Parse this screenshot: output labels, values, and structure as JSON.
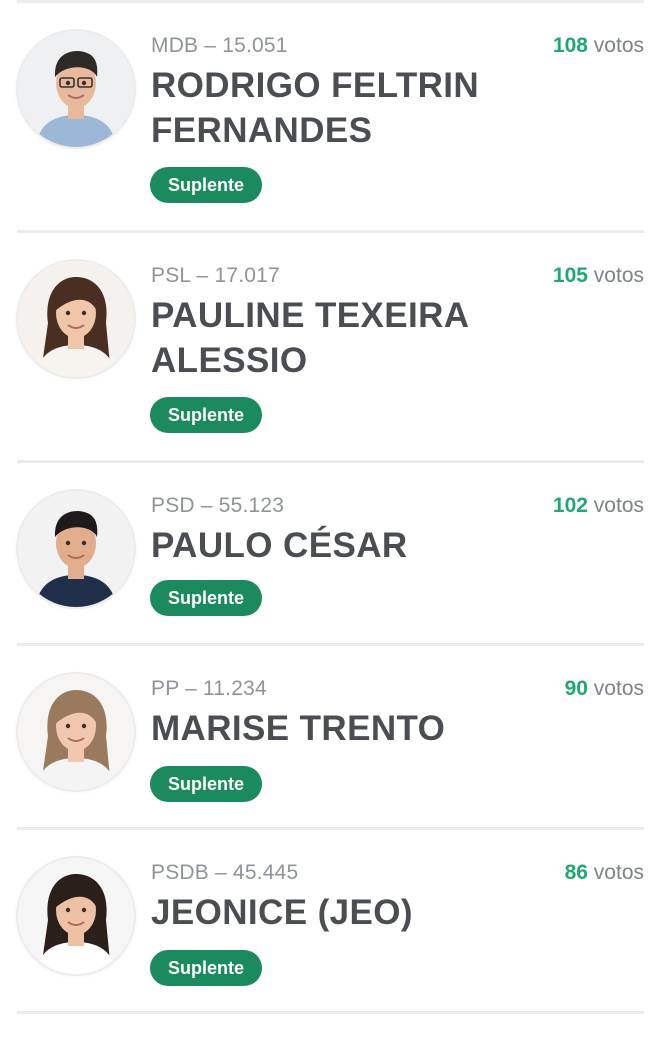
{
  "candidates": [
    {
      "party": "MDB – 15.051",
      "votes_number": "108",
      "votes_unit": " votos",
      "name": "RODRIGO FELTRIN FERNANDES",
      "status": "Suplente",
      "avatar": {
        "skin": "#e8b99a",
        "hair": "#2e2a27",
        "shirt": "#9db8d6",
        "bg": "#eef0f2"
      }
    },
    {
      "party": "PSL – 17.017",
      "votes_number": "105",
      "votes_unit": " votos",
      "name": "PAULINE TEXEIRA ALESSIO",
      "status": "Suplente",
      "avatar": {
        "skin": "#f0c6aa",
        "hair": "#4a2e22",
        "shirt": "#f7f3ef",
        "bg": "#f5f1ee"
      }
    },
    {
      "party": "PSD – 55.123",
      "votes_number": "102",
      "votes_unit": " votos",
      "name": "PAULO CÉSAR",
      "status": "Suplente",
      "avatar": {
        "skin": "#e2ad8c",
        "hair": "#1e1b1a",
        "shirt": "#1f2f4a",
        "bg": "#f2f2f2"
      }
    },
    {
      "party": "PP – 11.234",
      "votes_number": "90",
      "votes_unit": " votos",
      "name": "MARISE TRENTO",
      "status": "Suplente",
      "avatar": {
        "skin": "#f1c7b0",
        "hair": "#9a7a5c",
        "shirt": "#f4f4f4",
        "bg": "#f7f5f3"
      }
    },
    {
      "party": "PSDB – 45.445",
      "votes_number": "86",
      "votes_unit": " votos",
      "name": "JEONICE (JEO)",
      "status": "Suplente",
      "avatar": {
        "skin": "#eec1a4",
        "hair": "#2b1f1a",
        "shirt": "#ffffff",
        "bg": "#f6f6f6"
      }
    }
  ],
  "colors": {
    "votes_number": "#1fa870",
    "badge_bg": "#1b8a5f",
    "name_text": "#4a4e52",
    "party_text": "#8e949a"
  }
}
